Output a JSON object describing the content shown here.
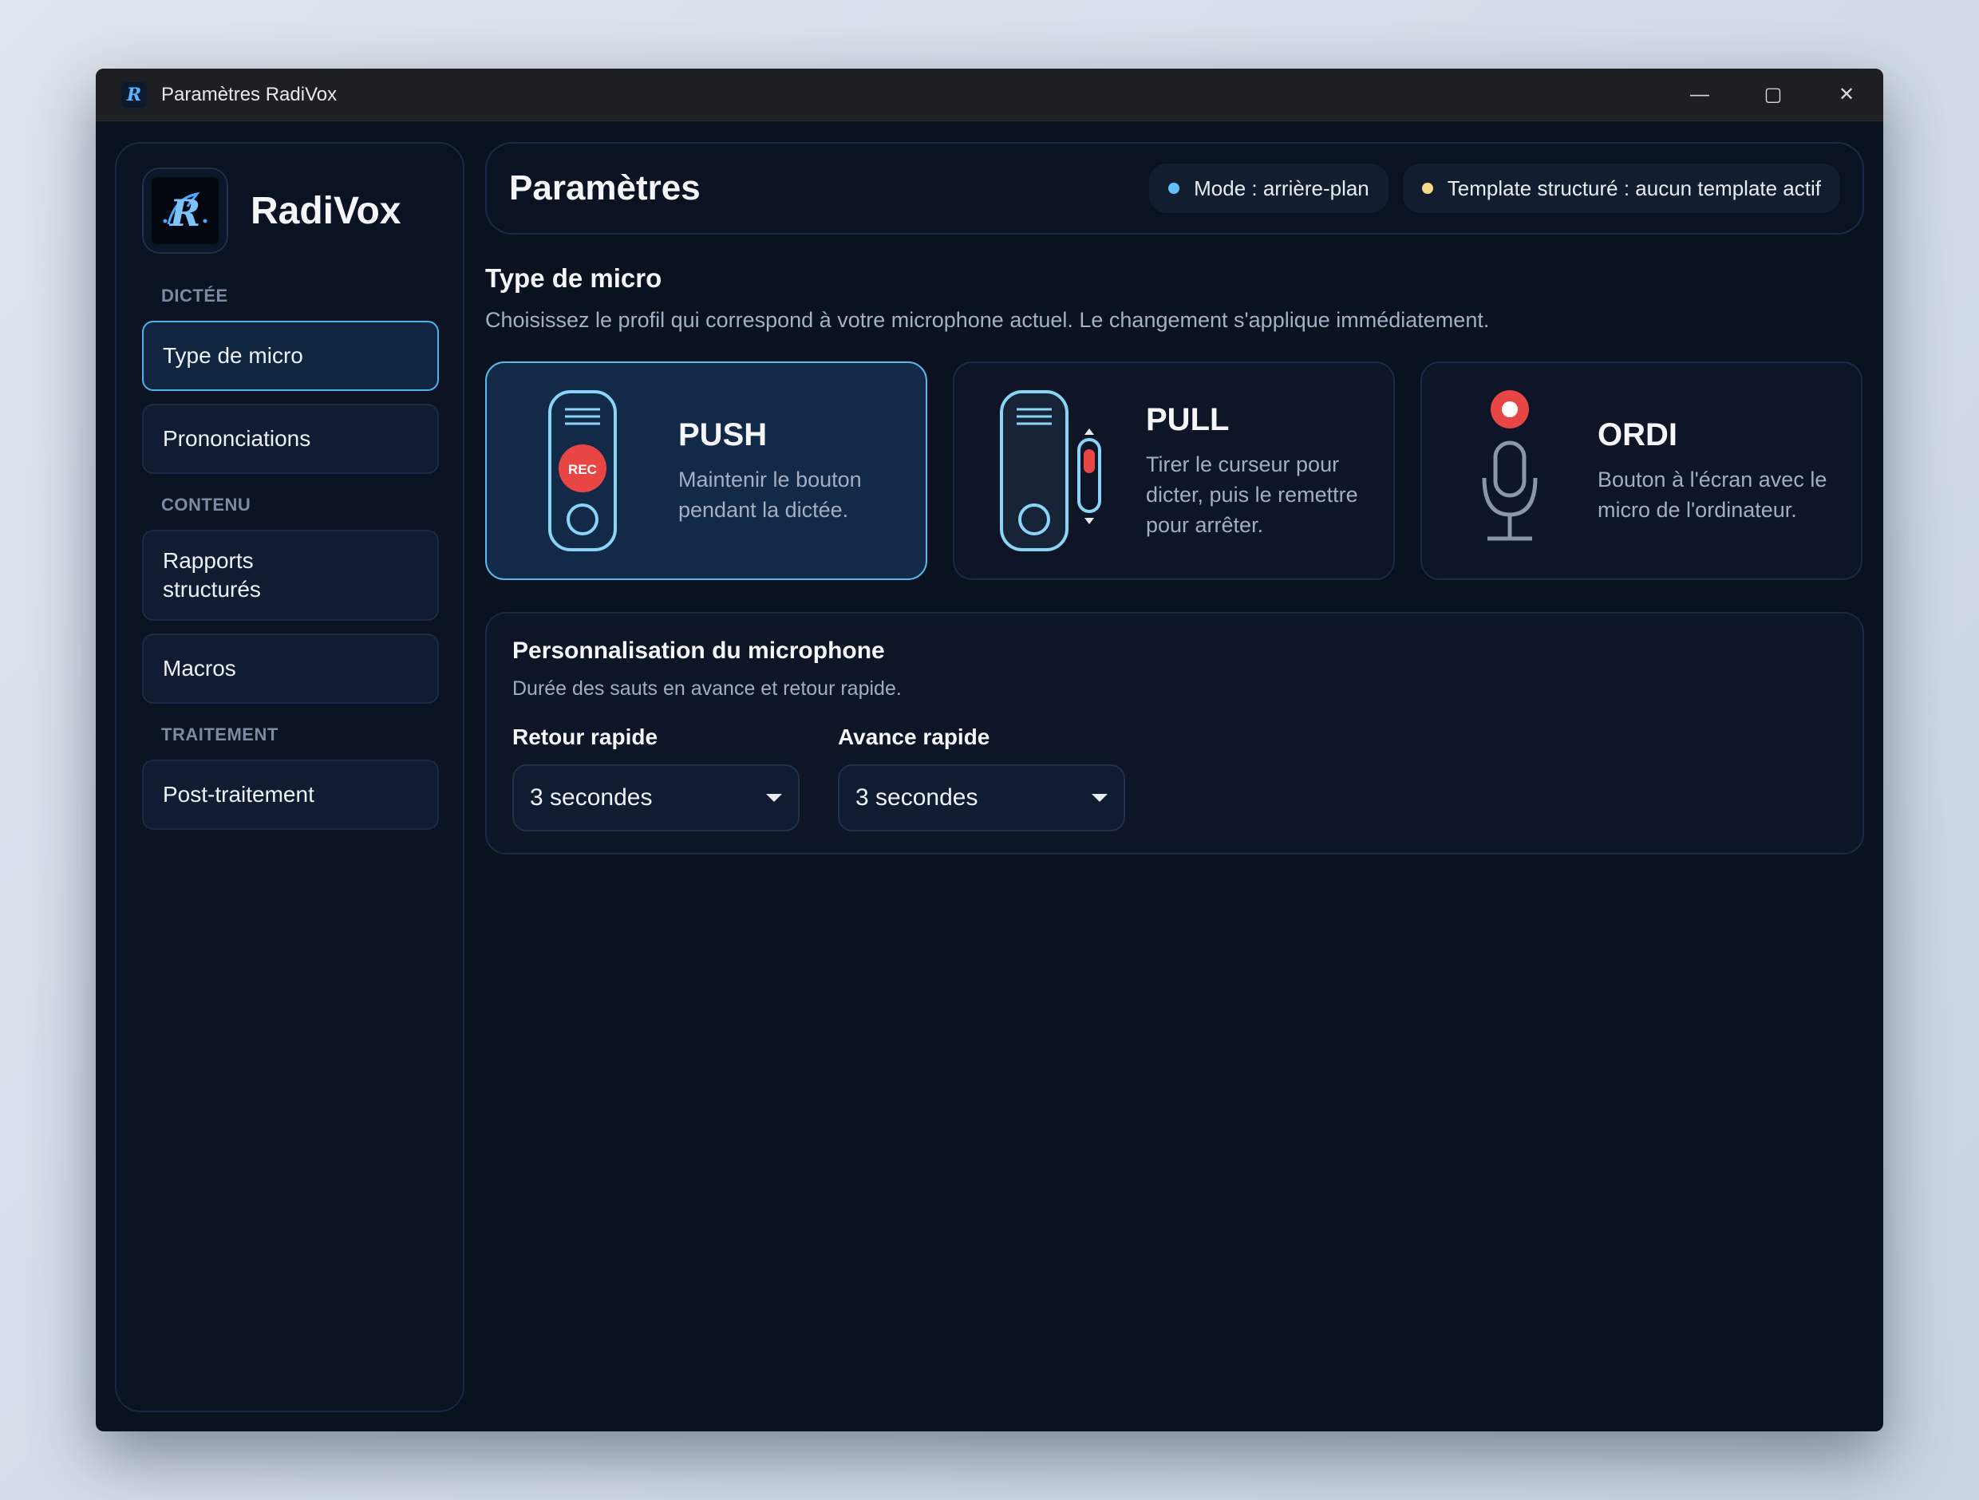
{
  "window": {
    "title": "Paramètres RadiVox",
    "controls": {
      "minimize": "—",
      "maximize": "▢",
      "close": "✕"
    }
  },
  "sidebar": {
    "brand": "RadiVox",
    "logo_glyph": "R",
    "sections": [
      {
        "label": "DICTÉE",
        "items": [
          {
            "label": "Type de micro",
            "active": true
          },
          {
            "label": "Prononciations",
            "active": false
          }
        ]
      },
      {
        "label": "CONTENU",
        "items": [
          {
            "label": "Rapports\nstructurés",
            "active": false
          },
          {
            "label": "Macros",
            "active": false
          }
        ]
      },
      {
        "label": "TRAITEMENT",
        "items": [
          {
            "label": "Post-traitement",
            "active": false
          }
        ]
      }
    ]
  },
  "header": {
    "title": "Paramètres",
    "pills": [
      {
        "text": "Mode : arrière-plan",
        "dot_color": "#5fc3f7"
      },
      {
        "text": "Template structuré : aucun template actif",
        "dot_color": "#f7d98a"
      }
    ]
  },
  "micro_section": {
    "title": "Type de micro",
    "description": "Choisissez le profil qui correspond à votre microphone actuel. Le changement s'applique immédiatement.",
    "cards": [
      {
        "id": "push",
        "title": "PUSH",
        "description": "Maintenir le bouton pendant la dictée.",
        "icon": "push-device-icon",
        "badge": "REC",
        "selected": true
      },
      {
        "id": "pull",
        "title": "PULL",
        "description": "Tirer le curseur pour dicter, puis le remettre pour arrêter.",
        "icon": "pull-device-icon",
        "selected": false
      },
      {
        "id": "ordi",
        "title": "ORDI",
        "description": "Bouton à l'écran avec le micro de l'ordinateur.",
        "icon": "microphone-icon",
        "selected": false
      }
    ]
  },
  "customization": {
    "title": "Personnalisation du microphone",
    "description": "Durée des sauts en avance et retour rapide.",
    "fields": [
      {
        "label": "Retour rapide",
        "value": "3 secondes"
      },
      {
        "label": "Avance rapide",
        "value": "3 secondes"
      }
    ]
  },
  "colors": {
    "accent": "#59b9ee",
    "rec": "#e84545",
    "background": "#0a111f"
  }
}
